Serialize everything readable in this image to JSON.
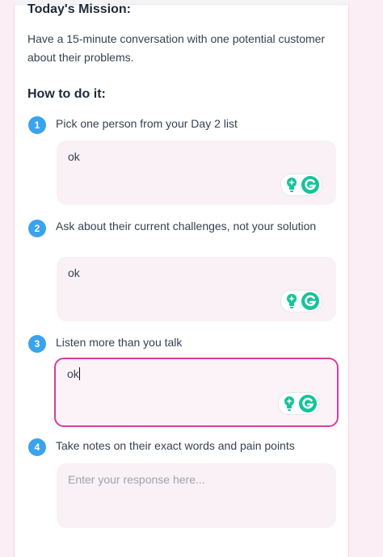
{
  "mission": {
    "title": "Today's Mission:",
    "text": "Have a 15-minute conversation with one potential customer about their problems."
  },
  "howto": {
    "title": "How to do it:"
  },
  "steps": [
    {
      "number": "1",
      "text": "Pick one person from your Day 2 list",
      "response": "ok"
    },
    {
      "number": "2",
      "text": "Ask about their current challenges, not your solution",
      "response": "ok"
    },
    {
      "number": "3",
      "text": "Listen more than you talk",
      "response": "ok"
    },
    {
      "number": "4",
      "text": "Take notes on their exact words and pain points",
      "response": "",
      "placeholder": "Enter your response here..."
    }
  ],
  "colors": {
    "accent_focus": "#d63f9a",
    "step_badge": "#3aa3ee",
    "grammarly_green": "#15c39a"
  },
  "icons": {
    "suggestion": "lightbulb-icon",
    "grammarly": "grammarly-g-icon"
  }
}
